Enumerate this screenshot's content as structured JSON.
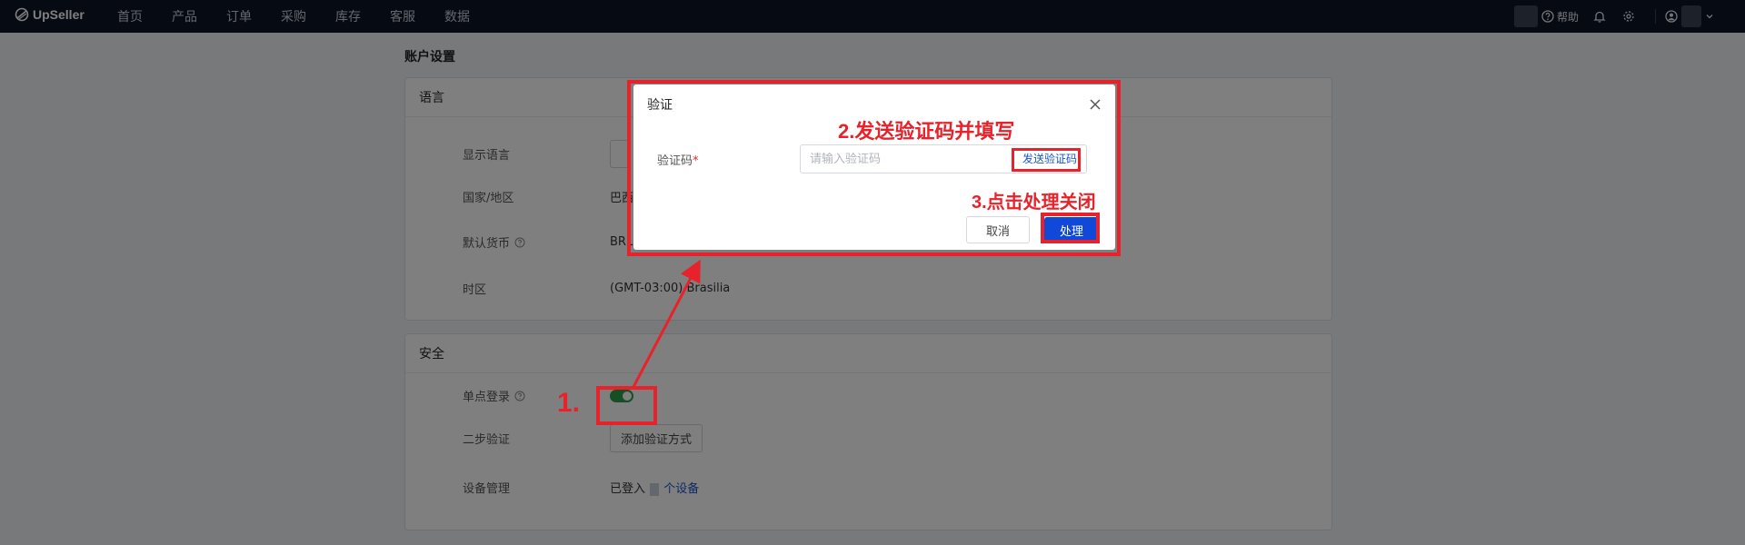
{
  "nav": {
    "brand": "UpSeller",
    "items": [
      "首页",
      "产品",
      "订单",
      "采购",
      "库存",
      "客服",
      "数据"
    ],
    "help": "帮助"
  },
  "page": {
    "title": "账户设置",
    "language_card": {
      "heading": "语言",
      "rows": [
        {
          "label": "显示语言",
          "value": ""
        },
        {
          "label": "国家/地区",
          "value": "巴西"
        },
        {
          "label": "默认货币",
          "value": "BRL"
        },
        {
          "label": "时区",
          "value": "(GMT-03:00) Brasilia"
        }
      ]
    },
    "security_card": {
      "heading": "安全",
      "sso_label": "单点登录",
      "sso_enabled": true,
      "two_step_label": "二步验证",
      "two_step_button": "添加验证方式",
      "device_label": "设备管理",
      "device_prefix": "已登入",
      "device_link": "个设备"
    }
  },
  "dialog": {
    "title": "验证",
    "code_label": "验证码",
    "required_mark": "*",
    "code_placeholder": "请输入验证码",
    "send_code": "发送验证码",
    "cancel": "取消",
    "confirm": "处理"
  },
  "annotations": {
    "step1": "1.",
    "step2": "2.发送验证码并填写",
    "step3": "3.点击处理关闭",
    "color": "#e8222a"
  },
  "colors": {
    "nav_bg": "#0c1526",
    "toggle_on": "#2e9e4b",
    "primary": "#1048d8",
    "link": "#1a55c7"
  }
}
